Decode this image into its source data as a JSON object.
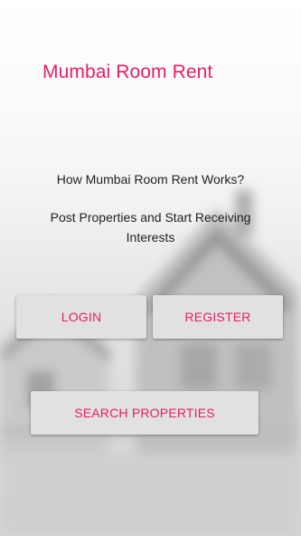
{
  "app": {
    "title": "Mumbai Room Rent"
  },
  "intro": {
    "heading": "How Mumbai Room Rent Works?",
    "subtitle": "Post Properties and Start Receiving Interests"
  },
  "buttons": {
    "login": "LOGIN",
    "register": "REGISTER",
    "search": "SEARCH PROPERTIES"
  },
  "colors": {
    "accent": "#e91e63",
    "button_bg": "#e1e1e1"
  }
}
